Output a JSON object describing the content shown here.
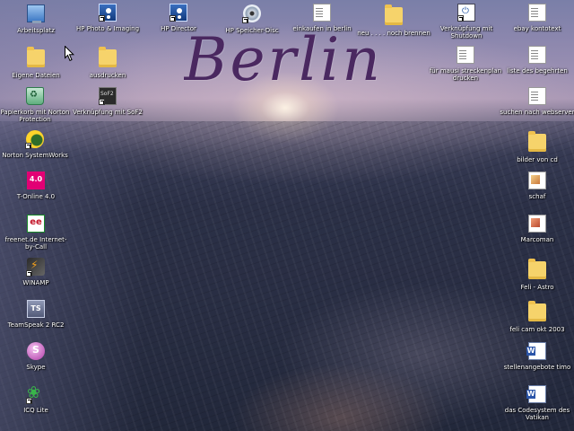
{
  "wallpaper": {
    "title": "Berlin"
  },
  "icons": [
    {
      "id": "arbeitsplatz",
      "label": "Arbeitsplatz",
      "icon": "computer-icon"
    },
    {
      "id": "hp-photo",
      "label": "HP Photo & Imaging",
      "icon": "hp-icon"
    },
    {
      "id": "hp-director",
      "label": "HP Director",
      "icon": "hp-icon"
    },
    {
      "id": "hp-speicher",
      "label": "HP Speicher-Disc",
      "icon": "disc-icon"
    },
    {
      "id": "einkaufen",
      "label": "einkaufen in berlin",
      "icon": "document-icon"
    },
    {
      "id": "neu-brennen",
      "label": "neu . . . . noch brennen",
      "icon": "folder-icon"
    },
    {
      "id": "verkn-shutdown",
      "label": "Verknüpfung mit Shutdown",
      "icon": "shutdown-icon"
    },
    {
      "id": "ebay",
      "label": "ebay kontotext",
      "icon": "document-icon"
    },
    {
      "id": "eigene-dateien",
      "label": "Eigene Dateien",
      "icon": "folder-icon"
    },
    {
      "id": "ausdrucken",
      "label": "ausdrucken",
      "icon": "folder-icon"
    },
    {
      "id": "mausi",
      "label": "für mausi streckenplan drucken",
      "icon": "document-icon"
    },
    {
      "id": "begehrten",
      "label": "liste des begehrten",
      "icon": "document-icon"
    },
    {
      "id": "papierkorb",
      "label": "Papierkorb mit Norton Protection",
      "icon": "recycle-bin-icon"
    },
    {
      "id": "verkn-sof2",
      "label": "Verknüpfung mit SoF2",
      "icon": "sof2-icon"
    },
    {
      "id": "webserver",
      "label": "suchen nach webserver",
      "icon": "document-icon"
    },
    {
      "id": "norton",
      "label": "Norton SystemWorks",
      "icon": "norton-icon"
    },
    {
      "id": "bilder-cd",
      "label": "bilder von cd",
      "icon": "folder-icon"
    },
    {
      "id": "tonline",
      "label": "T-Online 4.0",
      "icon": "t-online-icon",
      "glyph": "4.0"
    },
    {
      "id": "schaf",
      "label": "schaf",
      "icon": "image-icon"
    },
    {
      "id": "freenet",
      "label": "freenet.de Internet-by-Call",
      "icon": "freenet-icon",
      "glyph": "ee"
    },
    {
      "id": "marcoman",
      "label": "Marcoman",
      "icon": "image-icon"
    },
    {
      "id": "winamp",
      "label": "WINAMP",
      "icon": "winamp-icon"
    },
    {
      "id": "feli-astro",
      "label": "Feli - Astro",
      "icon": "folder-icon"
    },
    {
      "id": "teamspeak",
      "label": "TeamSpeak 2 RC2",
      "icon": "teamspeak-icon",
      "glyph": "TS"
    },
    {
      "id": "feli-cam",
      "label": "feli cam okt 2003",
      "icon": "folder-icon"
    },
    {
      "id": "skype",
      "label": "Skype",
      "icon": "skype-icon",
      "glyph": "S"
    },
    {
      "id": "stellenangebote",
      "label": "stellenangebote timo",
      "icon": "word-document-icon"
    },
    {
      "id": "icq",
      "label": "ICQ Lite",
      "icon": "icq-icon"
    },
    {
      "id": "codesystem",
      "label": "das Codesystem des Vatikan",
      "icon": "word-document-icon"
    }
  ]
}
